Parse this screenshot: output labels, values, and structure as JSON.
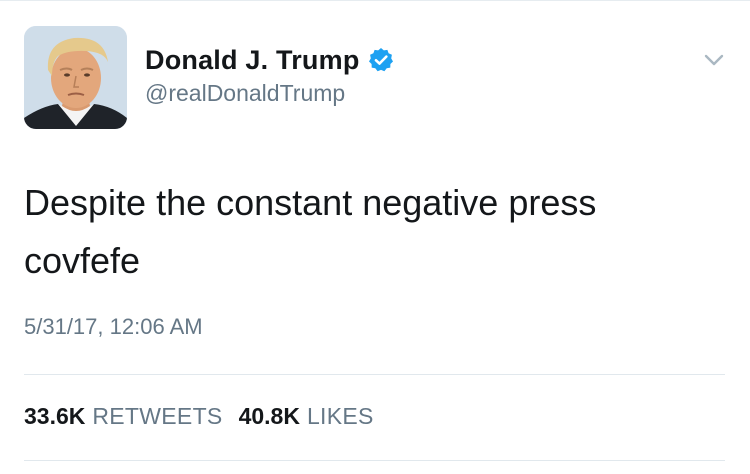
{
  "tweet": {
    "author": {
      "display_name": "Donald J. Trump",
      "handle": "@realDonaldTrump",
      "verified": true,
      "avatar_icon": "profile-photo-avatar"
    },
    "menu_icon": "chevron-down-icon",
    "text_lines": [
      "Despite the constant negative press",
      "covfefe"
    ],
    "timestamp": "5/31/17, 12:06 AM",
    "stats": {
      "retweets": {
        "count": "33.6K",
        "label": "RETWEETS"
      },
      "likes": {
        "count": "40.8K",
        "label": "LIKES"
      }
    }
  },
  "colors": {
    "text_primary": "#14171a",
    "text_secondary": "#657786",
    "verified_blue": "#1da1f2",
    "divider": "#e1e8ed"
  }
}
